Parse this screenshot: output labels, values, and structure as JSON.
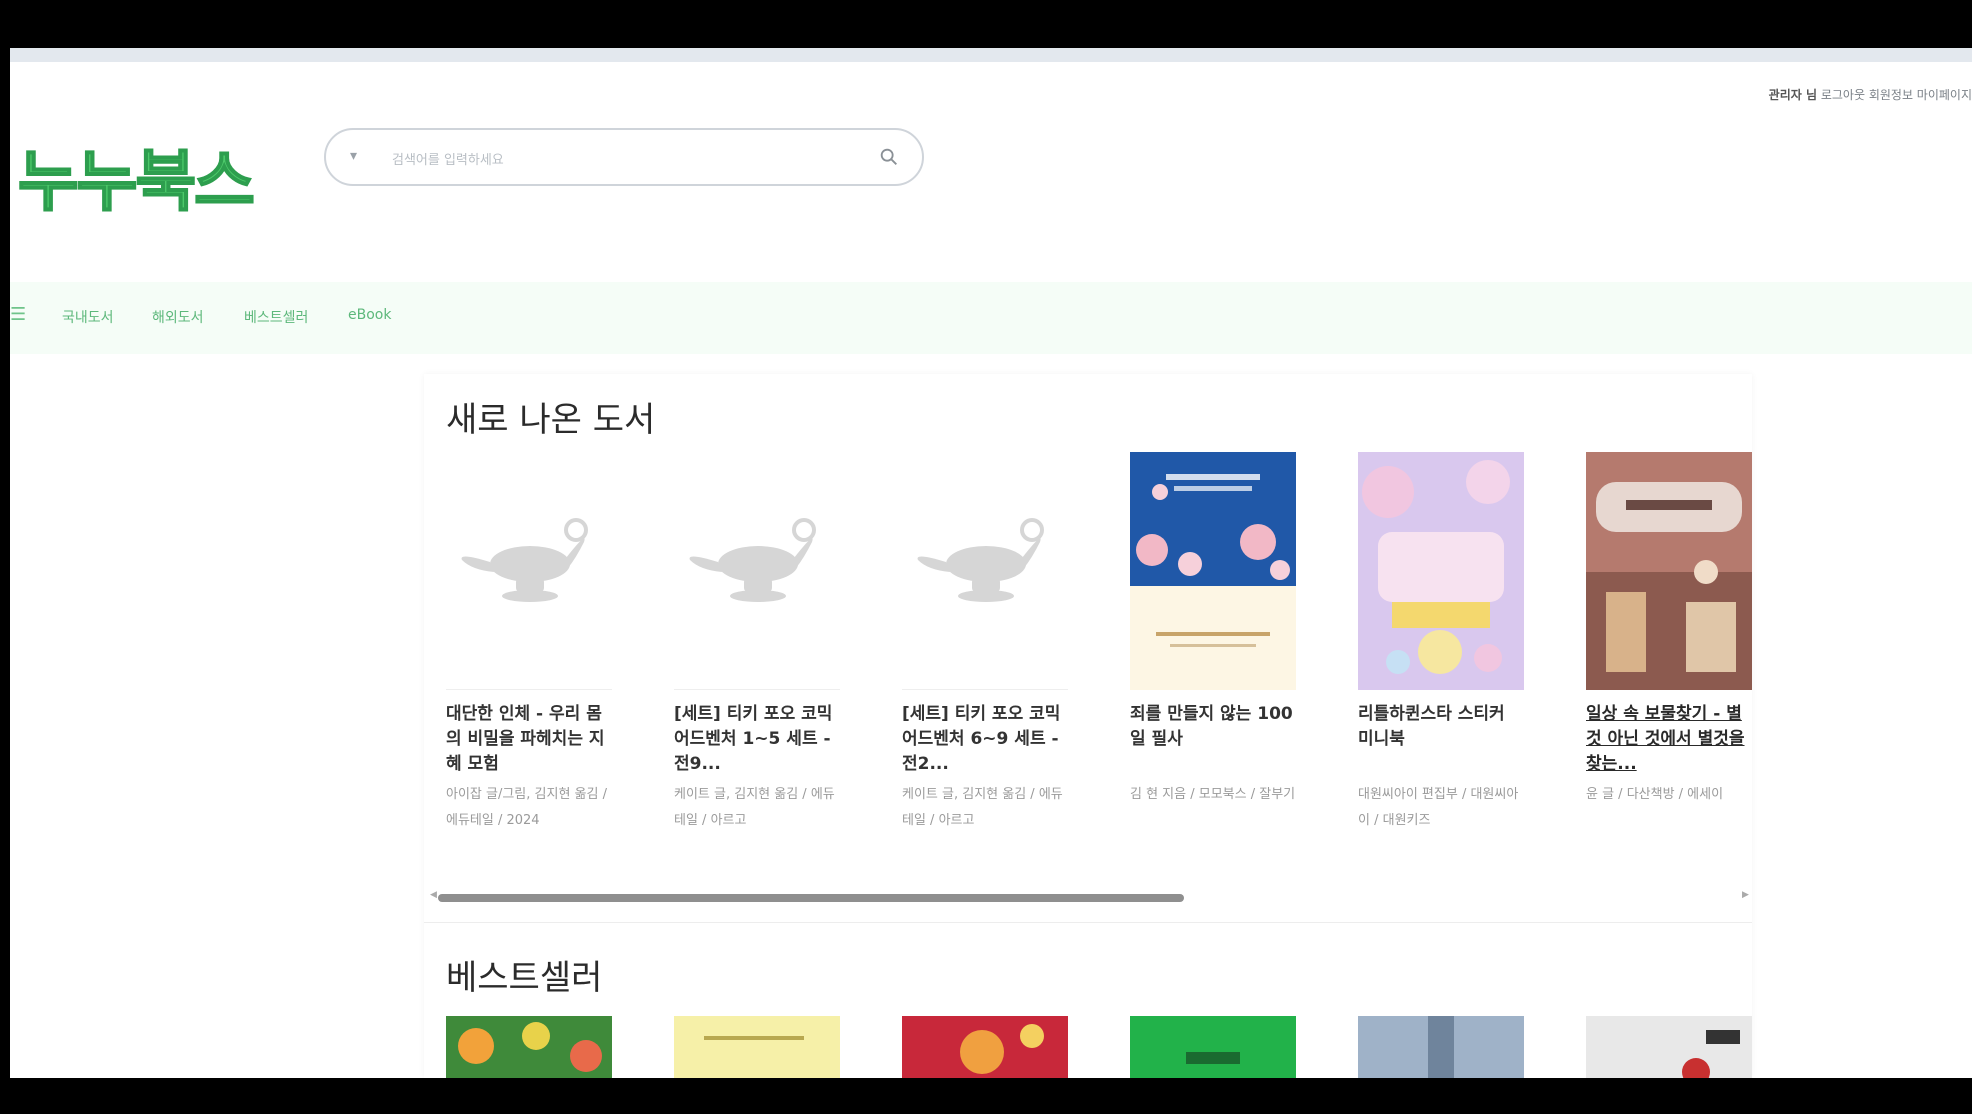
{
  "header": {
    "logo": "누누북스",
    "search": {
      "scope_label": "▾",
      "placeholder": "검색어를 입력하세요"
    },
    "user_menu": {
      "name": "관리자 님",
      "links": "로그아웃  회원정보  마이페이지"
    }
  },
  "nav": {
    "items": [
      "국내도서",
      "해외도서",
      "베스트셀러",
      "eBook"
    ]
  },
  "sections": {
    "new_books": {
      "title": "새로 나온 도서",
      "books": [
        {
          "title": "대단한 인체 - 우리 몸의 비밀을 파헤치는 지혜 모험",
          "meta": "아이잡 글/그림, 김지현 옮김 / 에듀테일 / 2024"
        },
        {
          "title": "[세트] 티키 포오 코믹 어드벤처 1~5 세트 - 전9...",
          "meta": "케이트 글, 김지현 옮김 / 에듀테일 / 아르고"
        },
        {
          "title": "[세트] 티키 포오 코믹 어드벤처 6~9 세트 - 전2...",
          "meta": "케이트 글, 김지현 옮김 / 에듀테일 / 아르고"
        },
        {
          "title": "죄를 만들지 않는 100일 필사",
          "meta": "김 현 지음 / 모모북스 / 잘부기"
        },
        {
          "title": "리틀하퀸스타 스티커 미니북",
          "meta": "대원씨아이 편집부 / 대원씨아이 / 대원키즈"
        },
        {
          "title": "일상 속 보물찾기 - 별것 아닌 것에서 별것을 찾는...",
          "meta": "윤 글 / 다산책방 / 에세이"
        }
      ]
    },
    "bestseller": {
      "title": "베스트셀러"
    }
  },
  "colors": {
    "brand": "#4cc96a",
    "nav_bg": "#f5fdf7",
    "scroll_thumb": "#8f8f8f"
  }
}
